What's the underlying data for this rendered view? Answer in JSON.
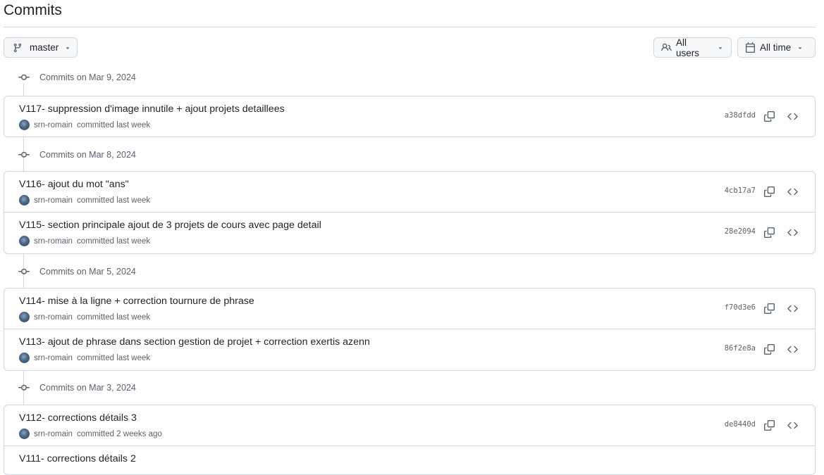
{
  "page": {
    "title": "Commits"
  },
  "toolbar": {
    "branch_label": "master",
    "users_label": "All users",
    "time_label": "All time"
  },
  "groups": [
    {
      "header": "Commits on Mar 9, 2024",
      "commits": [
        {
          "message": "V117- suppression d'image innutile + ajout projets detaillees",
          "author": "srn-romain",
          "time_text": "committed last week",
          "sha": "a38dfdd"
        }
      ]
    },
    {
      "header": "Commits on Mar 8, 2024",
      "commits": [
        {
          "message": "V116- ajout du mot \"ans\"",
          "author": "srn-romain",
          "time_text": "committed last week",
          "sha": "4cb17a7"
        },
        {
          "message": "V115- section principale ajout de 3 projets de cours avec page detail",
          "author": "srn-romain",
          "time_text": "committed last week",
          "sha": "28e2094"
        }
      ]
    },
    {
      "header": "Commits on Mar 5, 2024",
      "commits": [
        {
          "message": "V114- mise à la ligne + correction tournure de phrase",
          "author": "srn-romain",
          "time_text": "committed last week",
          "sha": "f70d3e6"
        },
        {
          "message": "V113- ajout de phrase dans section gestion de projet + correction exertis azenn",
          "author": "srn-romain",
          "time_text": "committed last week",
          "sha": "86f2e8a"
        }
      ]
    },
    {
      "header": "Commits on Mar 3, 2024",
      "commits": [
        {
          "message": "V112- corrections détails 3",
          "author": "srn-romain",
          "time_text": "committed 2 weeks ago",
          "sha": "de8440d"
        },
        {
          "message": "V111- corrections détails 2",
          "author": "",
          "time_text": "",
          "sha": ""
        }
      ]
    }
  ]
}
